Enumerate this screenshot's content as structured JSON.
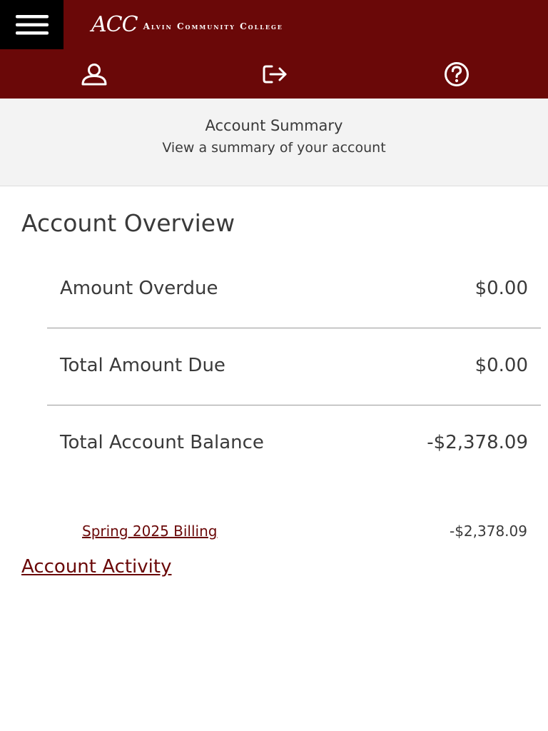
{
  "header": {
    "logo_mark": "ACC",
    "logo_text": "Alvin Community College",
    "brand_color": "#6a0808",
    "menu_icon": "hamburger-menu-icon",
    "icons": [
      "user-icon",
      "logout-icon",
      "help-icon"
    ]
  },
  "summary": {
    "title": "Account Summary",
    "subtitle": "View a summary of your account"
  },
  "overview": {
    "title": "Account Overview",
    "rows": [
      {
        "label": "Amount Overdue",
        "value": "$0.00"
      },
      {
        "label": "Total Amount Due",
        "value": "$0.00"
      },
      {
        "label": "Total Account Balance",
        "value": "-$2,378.09"
      }
    ],
    "billing": {
      "label": "Spring 2025 Billing",
      "value": "-$2,378.09"
    }
  },
  "links": {
    "account_activity": "Account Activity"
  }
}
